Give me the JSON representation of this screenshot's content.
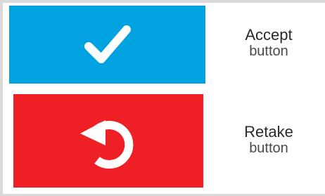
{
  "colors": {
    "accept_bg": "#00a3e0",
    "retake_bg": "#ee1f25",
    "icon": "#ffffff",
    "border": "#d9d9d9"
  },
  "accept": {
    "icon": "checkmark-icon",
    "title": "Accept",
    "subtitle": "button"
  },
  "retake": {
    "icon": "retake-arrow-icon",
    "title": "Retake",
    "subtitle": "button"
  }
}
